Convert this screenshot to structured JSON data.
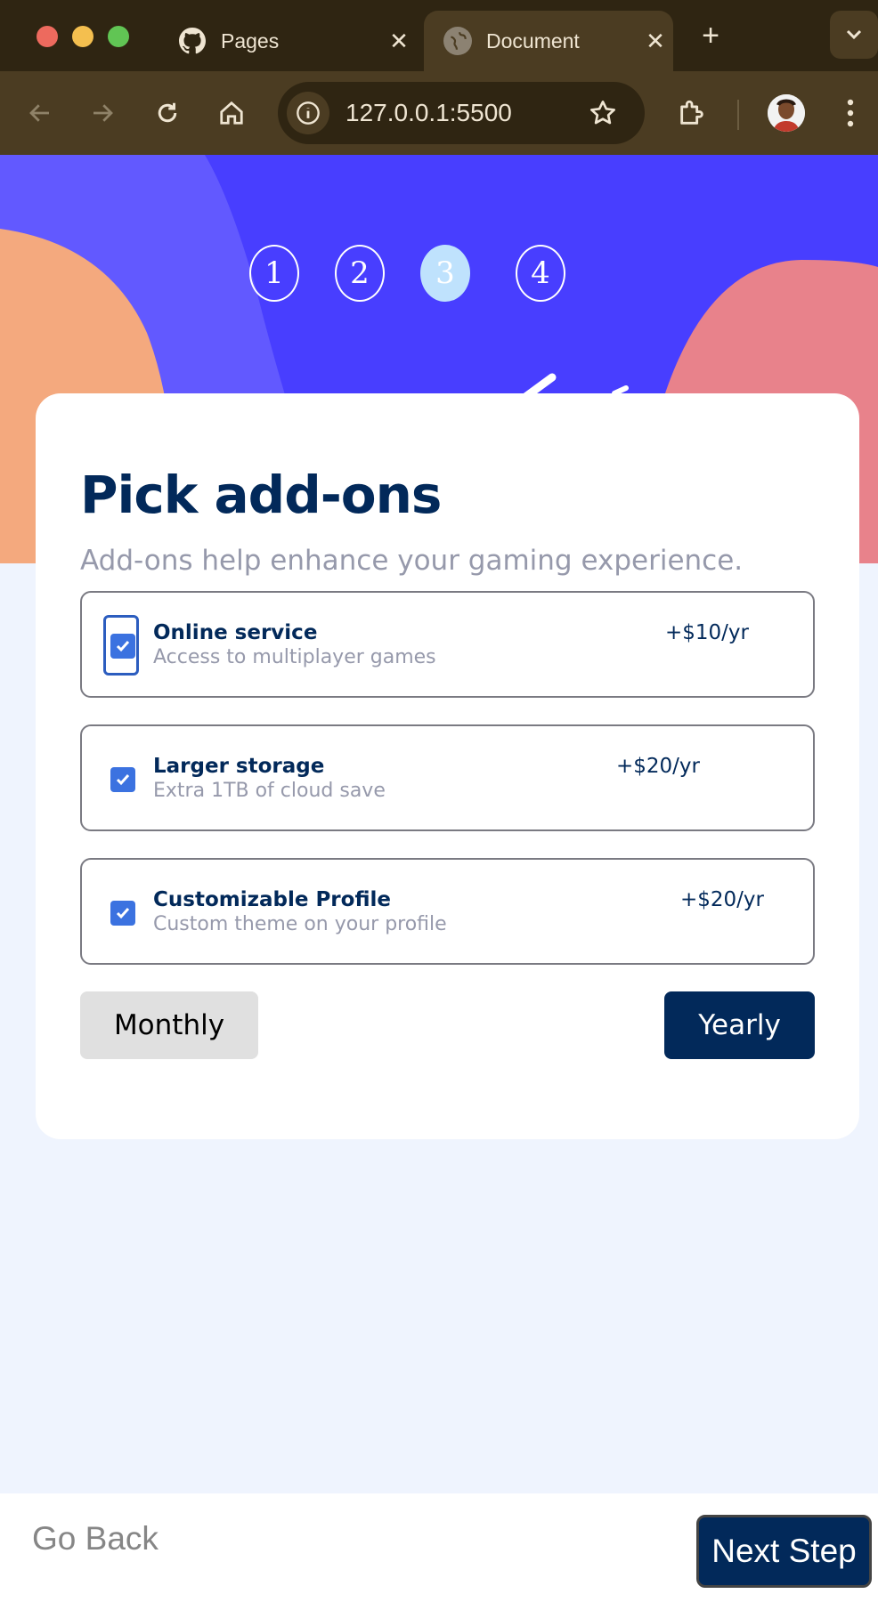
{
  "browser": {
    "tabs": [
      {
        "label": "Pages",
        "icon": "github-icon"
      },
      {
        "label": "Document",
        "icon": "globe-icon"
      }
    ],
    "new_tab": "+",
    "url": "127.0.0.1:5500"
  },
  "steps": [
    "1",
    "2",
    "3",
    "4"
  ],
  "active_step": "3",
  "card": {
    "title": "Pick add-ons",
    "subtitle": "Add-ons help enhance your gaming experience.",
    "addons": [
      {
        "name": "Online service",
        "description": "Access to multiplayer games",
        "price": "+$10/yr",
        "checked": true
      },
      {
        "name": "Larger storage",
        "description": "Extra 1TB of cloud save",
        "price": "+$20/yr",
        "checked": true
      },
      {
        "name": "Customizable Profile",
        "description": "Custom theme on your profile",
        "price": "+$20/yr",
        "checked": true
      }
    ],
    "monthly_label": "Monthly",
    "yearly_label": "Yearly"
  },
  "footer": {
    "back_label": "Go Back",
    "next_label": "Next Step"
  },
  "colors": {
    "marine_blue": "#02295a",
    "purplish_blue": "#483eff",
    "light_blue": "#bfe2fd",
    "cool_gray": "#9699ab",
    "checkbox_blue": "#3b72e0",
    "orange_blob": "#f4a97e",
    "pink_blob": "#e8828b"
  }
}
